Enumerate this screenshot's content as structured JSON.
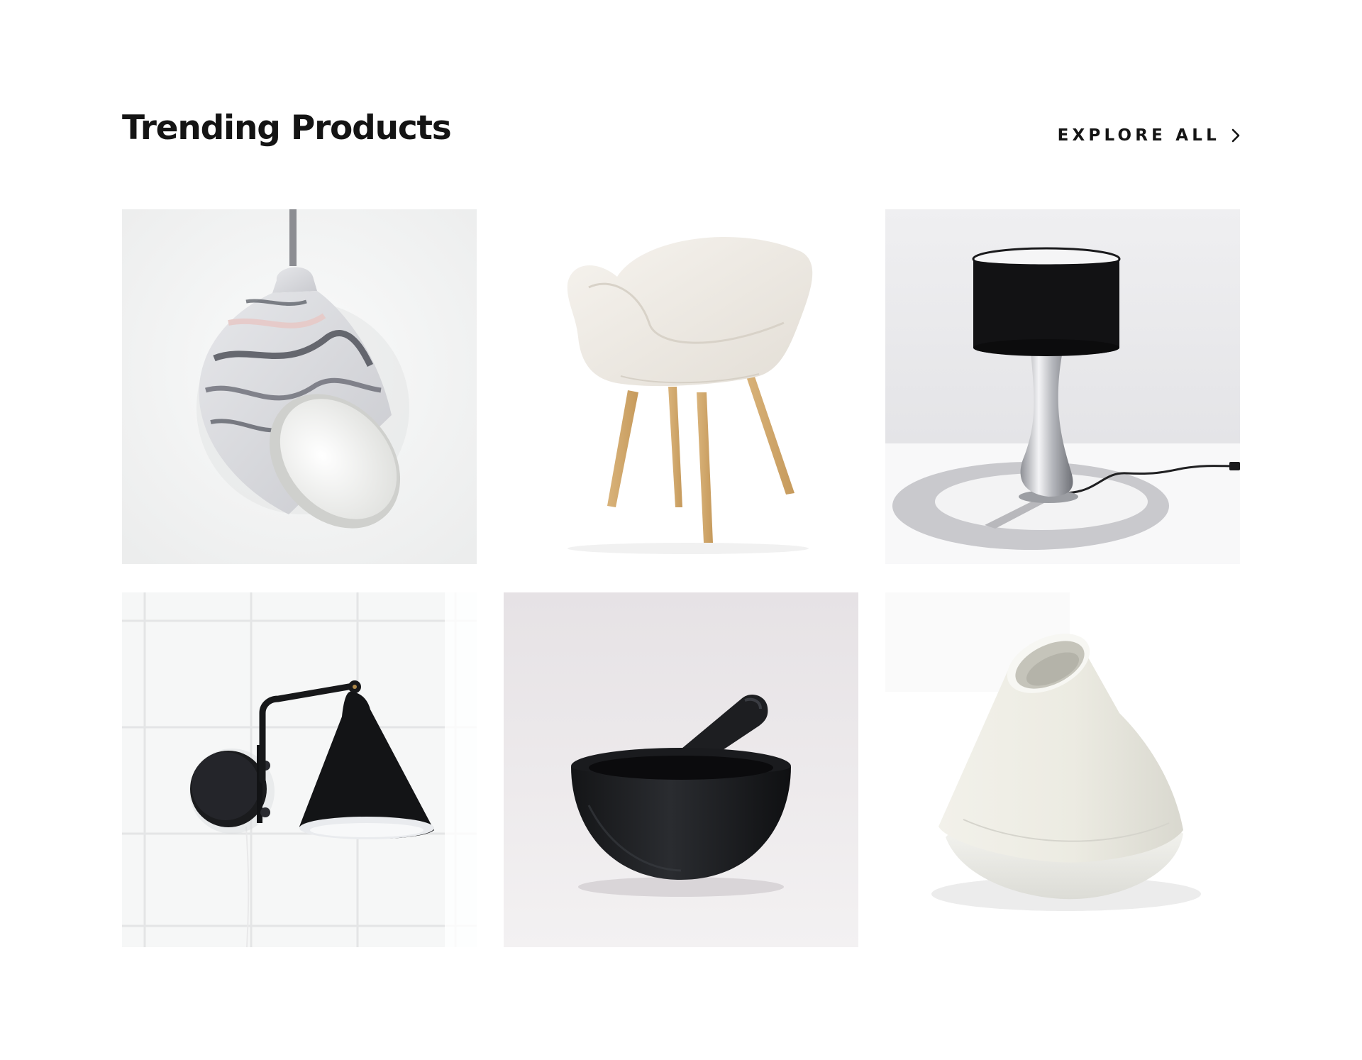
{
  "section": {
    "title": "Trending Products"
  },
  "explore_link": {
    "label": "EXPLORE ALL",
    "icon": "chevron-right-icon"
  },
  "products": [
    {
      "name": "marbled-pendant-lamp",
      "backdrop": "#f2f2f3"
    },
    {
      "name": "white-shell-armchair",
      "backdrop": "#ffffff"
    },
    {
      "name": "black-shade-table-lamp",
      "backdrop": "#ececee"
    },
    {
      "name": "black-wall-sconce",
      "backdrop": "#f7f8f8"
    },
    {
      "name": "black-mortar-and-pestle",
      "backdrop": "#ebe8ea"
    },
    {
      "name": "white-ceramic-vase",
      "backdrop": "#ffffff"
    }
  ],
  "colors": {
    "text": "#141414",
    "background": "#ffffff"
  }
}
